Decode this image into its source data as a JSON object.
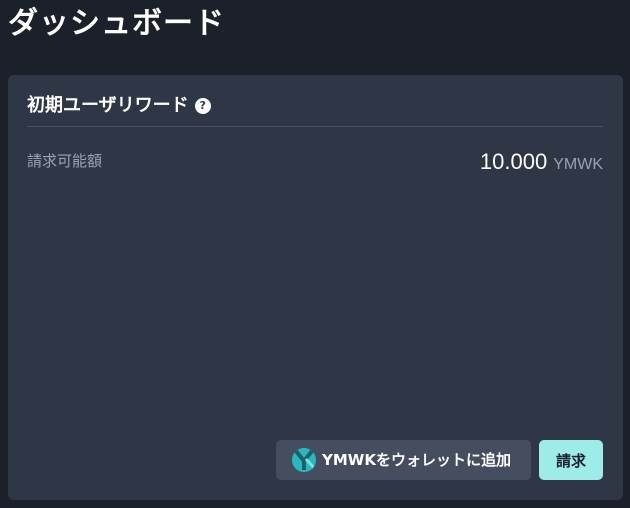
{
  "header": {
    "title": "ダッシュボード"
  },
  "card": {
    "title": "初期ユーザリワード",
    "help_icon": "?",
    "claimable_label": "請求可能額",
    "claimable_amount": "10.000",
    "claimable_unit": "YMWK",
    "add_wallet_label": "YMWKをウォレットに追加",
    "claim_label": "請求"
  },
  "colors": {
    "background": "#1b202a",
    "card": "#2f3747",
    "claim_button": "#9eece8",
    "logo": "#27b9bd"
  },
  "icons": {
    "help": "question-circle-icon",
    "token_logo": "ymwk-logo-icon"
  }
}
